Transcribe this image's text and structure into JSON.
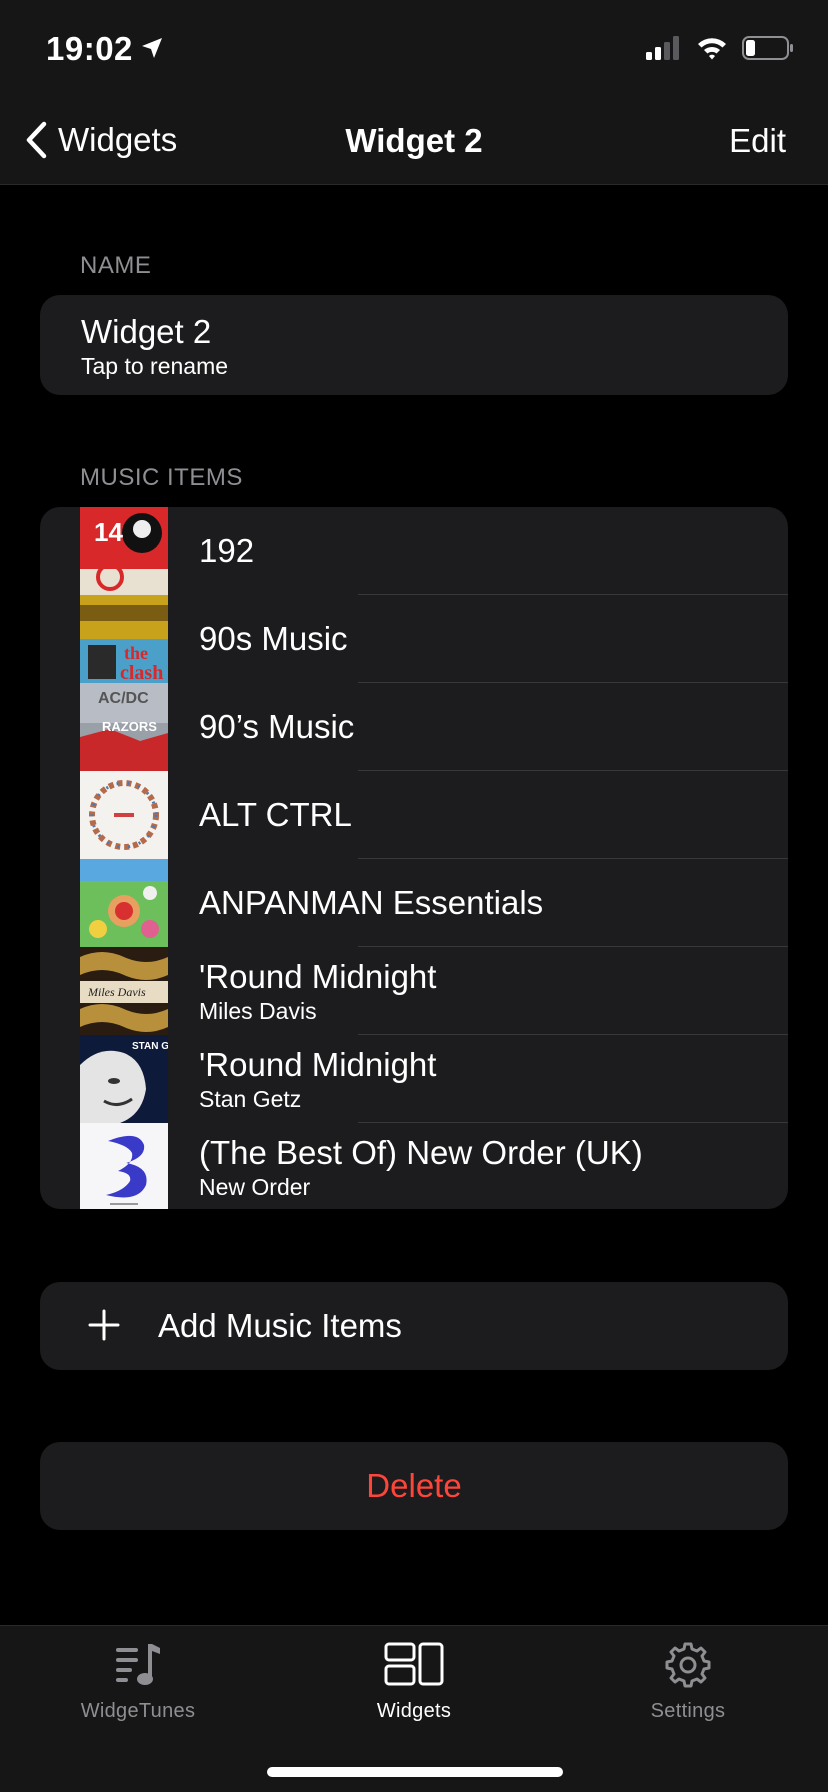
{
  "status": {
    "time": "19:02"
  },
  "nav": {
    "back_label": "Widgets",
    "title": "Widget 2",
    "edit_label": "Edit"
  },
  "name_section": {
    "header": "NAME",
    "title": "Widget 2",
    "subtitle": "Tap to rename"
  },
  "music_section": {
    "header": "MUSIC ITEMS",
    "items": [
      {
        "title": "192",
        "subtitle": ""
      },
      {
        "title": "90s Music",
        "subtitle": ""
      },
      {
        "title": "90’s Music",
        "subtitle": ""
      },
      {
        "title": "ALT CTRL",
        "subtitle": ""
      },
      {
        "title": "ANPANMAN Essentials",
        "subtitle": ""
      },
      {
        "title": "'Round Midnight",
        "subtitle": "Miles Davis"
      },
      {
        "title": "'Round Midnight",
        "subtitle": "Stan Getz"
      },
      {
        "title": "(The Best Of) New Order (UK)",
        "subtitle": "New Order"
      }
    ]
  },
  "add_label": "Add Music Items",
  "delete_label": "Delete",
  "tabs": [
    {
      "label": "WidgeTunes",
      "icon": "music-list-icon",
      "active": false
    },
    {
      "label": "Widgets",
      "icon": "widgets-icon",
      "active": true
    },
    {
      "label": "Settings",
      "icon": "gear-icon",
      "active": false
    }
  ],
  "colors": {
    "accent_delete": "#ff453a",
    "inactive_tab": "#8e8e93",
    "card_bg": "#1c1c1e"
  }
}
